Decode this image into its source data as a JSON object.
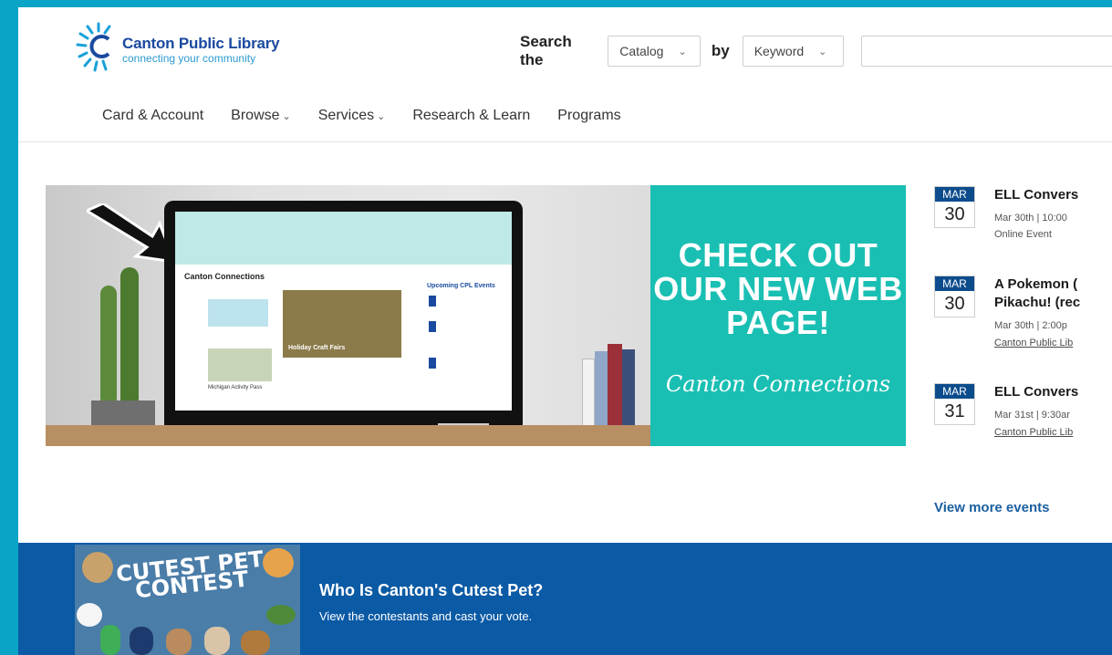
{
  "header": {
    "logo_name": "Canton Public Library",
    "logo_tagline": "connecting your community",
    "search_label": "Search the",
    "catalog_select": "Catalog",
    "by_label": "by",
    "keyword_select": "Keyword",
    "search_placeholder": ""
  },
  "nav": {
    "items": [
      {
        "label": "Card & Account"
      },
      {
        "label": "Browse"
      },
      {
        "label": "Services"
      },
      {
        "label": "Research & Learn"
      },
      {
        "label": "Programs"
      }
    ]
  },
  "hero": {
    "screen_title": "Canton Connections",
    "screen_events": "Upcoming CPL Events",
    "screen_tile_a": "Holiday Craft Fairs",
    "screen_tile_b": "Michigan Activity Pass",
    "promo_headline": "CHECK OUT OUR NEW WEB PAGE!",
    "promo_script": "Canton Connections",
    "promo_color": "#1abfb3"
  },
  "events": [
    {
      "month": "MAR",
      "day": "30",
      "title": "ELL Convers",
      "meta": "Mar 30th | 10:00",
      "location": "Online Event"
    },
    {
      "month": "MAR",
      "day": "30",
      "title_line1": "A Pokemon (",
      "title_line2": "Pikachu! (rec",
      "meta": "Mar 30th | 2:00p",
      "location": "Canton Public Lib"
    },
    {
      "month": "MAR",
      "day": "31",
      "title": "ELL Convers",
      "meta": "Mar 31st | 9:30ar",
      "location": "Canton Public Lib"
    }
  ],
  "view_more": "View more events",
  "contest": {
    "image_text_line1": "CUTEST PET",
    "image_text_line2": "CONTEST",
    "title": "Who Is Canton's Cutest Pet?",
    "subtitle": "View the contestants and cast your vote.",
    "bg_color": "#0b5aa5"
  },
  "colors": {
    "frame": "#0aa4c7",
    "calendar_month": "#0d4c8c",
    "link": "#1a5fa0"
  }
}
